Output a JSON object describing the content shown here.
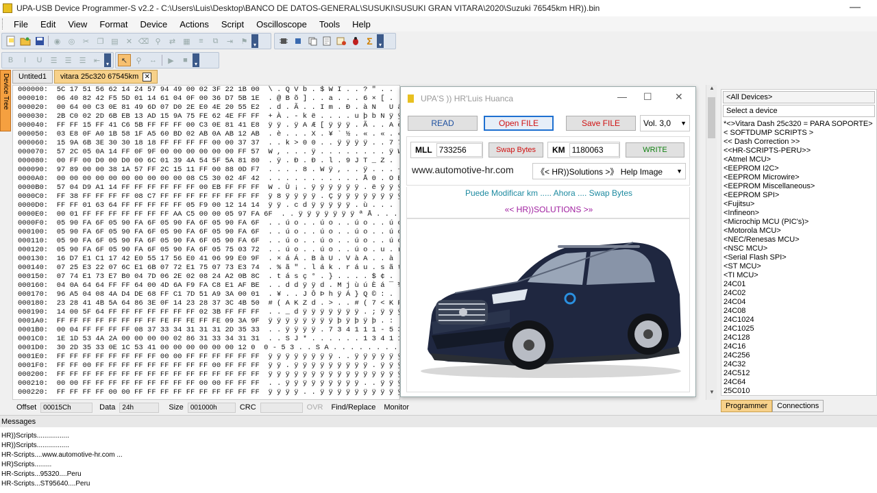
{
  "window": {
    "title": "UPA-USB Device Programmer-S v2.2 - C:\\Users\\Luis\\Desktop\\BANCO DE DATOS-GENERAL\\SUSUKI\\SUSUKI GRAN VITARA\\2020\\Suzuki 76545km HR)).bin"
  },
  "menu": [
    "File",
    "Edit",
    "View",
    "Format",
    "Device",
    "Actions",
    "Script",
    "Oscilloscope",
    "Tools",
    "Help"
  ],
  "left_tab": "Device Tree",
  "doc_tabs": [
    "Untited1",
    "vitara 25c320 67545km"
  ],
  "hex_rows": [
    "000000:  5C 17 51 56 62 14 24 57 94 49 00 02 3F 22 1B 00  \\ . Q V b . $ W I . . ? \" . .",
    "000010:  06 40 82 42 F5 5D 01 14 61 04 0F 00 36 D7 5B 1E  . @ B õ ] . . a . . . 6 × [ .",
    "000020:  00 64 00 C3 0E 81 49 6D 07 D0 2E E0 4E 20 55 E2  . d . Ã . . I m . Ð . à N   U â",
    "000030:  2B C0 02 2D 6B EB 13 AD 15 9A 75 FE 62 4E FF FF  + À . - k ë . . . . u þ b N ÿ ÿ",
    "000040:  FF FF 15 FF 41 C6 5B FF FF FF 00 C3 0E 81 41 E8  ÿ ÿ . ÿ A Æ [ ÿ ÿ ÿ . Ã . . A è",
    "000050:  03 E8 0F A0 1B 58 1F A5 60 BD 02 AB 0A AB 12 AB  . è . . . X . ¥ ` ½ . « . « . «",
    "000060:  15 9A 6B 3E 30 30 18 18 FF FF FF FF 00 00 37 37  . . k > 0 0 . . ÿ ÿ ÿ ÿ . . 7 7",
    "000070:  57 2C 05 0A 14 FF 0F 9F 00 00 00 00 00 00 FF 57  W , . . . ÿ . . . . . . . . ÿ W",
    "000080:  00 FF 00 D0 00 D0 00 6C 01 39 4A 54 5F 5A 81 80  . ÿ . Ð . Ð . l . 9 J T _ Z . .",
    "000090:  97 89 00 00 38 1A 57 FF 2C 15 11 FF 00 88 0D F7  . . . . 8 . W ÿ , . . ÿ . . . ÷",
    "0000A0:  00 00 00 00 00 00 00 00 00 00 08 C5 30 02 4F 42  . . . . . . . . . . . Å 0 . O B",
    "0000B0:  57 04 D9 A1 14 FF FF FF FF FF FF 00 EB FF FF FF  W . Ù ¡ . ÿ ÿ ÿ ÿ ÿ ÿ . ë ÿ ÿ ÿ",
    "0000C0:  FF 38 FF FF FF FF 08 C7 FF FF FF FF FF FF FF FF  ÿ 8 ÿ ÿ ÿ ÿ . Ç ÿ ÿ ÿ ÿ ÿ ÿ ÿ ÿ",
    "0000D0:  FF FF 01 63 64 FF FF FF FF FF 05 F9 00 12 14 14  ÿ ÿ . c d ÿ ÿ ÿ ÿ ÿ . ù . . . .",
    "0000E0:  00 01 FF FF FF FF FF FF FF AA C5 00 00 05 97 FA 6F  . . ÿ ÿ ÿ ÿ ÿ ÿ ÿ ª Å . . . ú o",
    "0000F0:  05 90 FA 6F 05 90 FA 6F 05 90 FA 6F 05 90 FA 6F  . . ú o . . ú o . . ú o . . ú o",
    "000100:  05 90 FA 6F 05 90 FA 6F 05 90 FA 6F 05 90 FA 6F  . . ú o . . ú o . . ú o . . ú o",
    "000110:  05 90 FA 6F 05 90 FA 6F 05 90 FA 6F 05 90 FA 6F  . . ú o . . ú o . . ú o . . ú o",
    "000120:  05 90 FA 6F 05 90 FA 6F 05 90 FA 6F 05 75 03 72  . . ú o . . ú o . . ú o . u . r",
    "000130:  16 D7 E1 C1 17 42 E0 55 17 56 E0 41 06 99 E0 9F  . × á Á . B à U . V à A . . à .",
    "000140:  07 25 E3 22 07 6C E1 6B 07 72 E1 75 07 73 E3 74  . % ã \" . l á k . r á u . s ã t",
    "000150:  07 74 E1 73 E7 B0 04 7D 06 2E 02 08 24 A2 0B 8C  . t á s ç ° . } . . . . $ ¢ . .",
    "000160:  04 0A 64 64 FF FF 64 00 4D 6A F9 FA C8 E1 AF BE  . . d d ÿ ÿ d . M j ù ú È á ¯ ¾",
    "000170:  96 A5 04 08 4A D4 DE 68 FF C1 7D 51 A9 3A 00 01  . ¥ . . J Ô Þ h ÿ Á } Q © : . .",
    "000180:  23 28 41 4B 5A 64 86 3E 0F 14 23 28 37 3C 4B 50  # ( A K Z d . > . . # ( 7 < K P",
    "000190:  14 00 5F 64 FF FF FF FF FF FF FF 02 3B FF FF FF  . . _ d ÿ ÿ ÿ ÿ ÿ ÿ ÿ . ; ÿ ÿ ÿ",
    "0001A0:  FF FF FF FF FF FF FF FF FE FF FE FF FE 09 3A 9F  ÿ ÿ ÿ ÿ ÿ ÿ ÿ ÿ þ ÿ þ ÿ þ . : .",
    "0001B0:  00 04 FF FF FF FF 08 37 33 34 31 31 31 2D 35 33  . . ÿ ÿ ÿ ÿ . 7 3 4 1 1 1 - 5 3",
    "0001C0:  1E 1D 53 4A 2A 00 00 00 00 02 86 31 33 34 31 31  . . S J * . . . . . . 1 3 4 1 1",
    "0001D0:  30 2D 35 33 0E 1C 53 41 00 00 00 00 00 00 12 0  0 - 5 3 . . S A . . . . . . . .",
    "0001E0:  FF FF FF FF FF FF FF FF 00 00 FF FF FF FF FF FF  ÿ ÿ ÿ ÿ ÿ ÿ ÿ ÿ . . ÿ ÿ ÿ ÿ ÿ ÿ",
    "0001F0:  FF FF 00 FF FF FF FF FF FF FF FF FF 00 FF FF FF  ÿ ÿ . ÿ ÿ ÿ ÿ ÿ ÿ ÿ ÿ ÿ . ÿ ÿ ÿ",
    "000200:  FF FF FF FF FF FF FF FF FF FF FF FF FF FF FF FF  ÿ ÿ ÿ ÿ ÿ ÿ ÿ ÿ ÿ ÿ ÿ ÿ ÿ ÿ ÿ ÿ",
    "000210:  00 00 FF FF FF FF FF FF FF FF FF 00 00 FF FF FF  . . ÿ ÿ ÿ ÿ ÿ ÿ ÿ ÿ ÿ . . ÿ ÿ ÿ",
    "000220:  FF FF FF FF 00 00 FF FF FF FF FF FF FF FF FF FF  ÿ ÿ ÿ ÿ . . ÿ ÿ ÿ ÿ ÿ ÿ ÿ ÿ ÿ ÿ"
  ],
  "dialog": {
    "title": "UPA'S )) HR'Luis Huanca",
    "read": "READ",
    "open_file": "Open  FILE",
    "save_file": "Save  FILE",
    "vol": "Vol. 3,0",
    "mll_label": "MLL",
    "mll_value": "733256",
    "swap_bytes": "Swap Bytes",
    "km_label": "KM",
    "km_value": "1180063",
    "write": "WRITE",
    "website": "www.automotive-hr.com",
    "solutions_select": "《< HR))Solutions >》 Help Image",
    "hint": "Puede Modificar  km ..... Ahora .... Swap Bytes",
    "brand": "«< HR))SOLUTIONS >»",
    "colors": {
      "blue_text": "#1d6fa0",
      "purple_text": "#a020a0",
      "red_text": "#d01010"
    }
  },
  "device_select": {
    "all_devices": "<All Devices>",
    "placeholder": "Select a device"
  },
  "device_list": [
    "*<>Vitara Dash 25c320 = PARA SOPORTE>",
    "< SOFTDUMP SCRIPTS >",
    "<< Dash Correction >>",
    "<<HR-SCRIPTS-PERU>>",
    "<Atmel MCU>",
    "<EEPROM I2C>",
    "<EEPROM Microwire>",
    "<EEPROM Miscellaneous>",
    "<EEPROM SPI>",
    "<Fujitsu>",
    "<Infineon>",
    "<Microchip MCU (PIC's)>",
    "<Motorola MCU>",
    "<NEC/Renesas MCU>",
    "<NSC MCU>",
    "<Serial Flash SPI>",
    "<ST MCU>",
    "<TI MCU>",
    "24C01",
    "24C02",
    "24C04",
    "24C08",
    "24C1024",
    "24C1025",
    "24C128",
    "24C16",
    "24C256",
    "24C32",
    "24C512",
    "24C64",
    "25C010"
  ],
  "bottom_tabs": [
    "Programmer",
    "Connections"
  ],
  "status": {
    "offset_label": "Offset",
    "offset_value": "00015Ch",
    "data_label": "Data",
    "data_value": "24h",
    "size_label": "Size",
    "size_value": "001000h",
    "crc_label": "CRC",
    "crc_value": "",
    "ovr": "OVR",
    "find_replace": "Find/Replace",
    "monitor": "Monitor"
  },
  "messages_title": "Messages",
  "messages": [
    "HR))Scripts.................",
    "HR))Scripts.................",
    "HR-Scripts....www.automotive-hr.com ...",
    "HR)Scripts.........",
    "HR-Scripts...95320....Peru",
    "HR-Scripts...ST95640....Peru"
  ]
}
